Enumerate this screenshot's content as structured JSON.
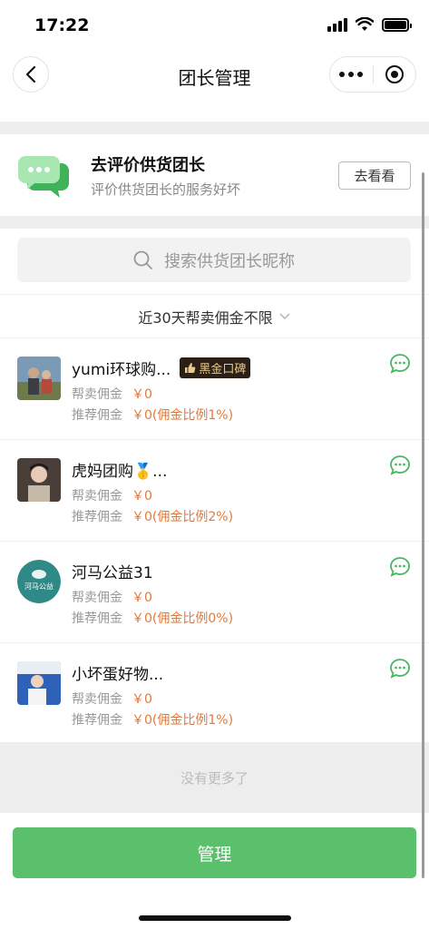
{
  "status_bar": {
    "time": "17:22"
  },
  "nav": {
    "title": "团长管理"
  },
  "eval_card": {
    "title": "去评价供货团长",
    "subtitle": "评价供货团长的服务好坏",
    "button": "去看看"
  },
  "search": {
    "placeholder": "搜索供货团长昵称"
  },
  "filter": {
    "label": "近30天帮卖佣金不限"
  },
  "leaders": [
    {
      "name": "yumi环球购...",
      "badge": "黑金口碑",
      "sell_label": "帮卖佣金",
      "sell_amount": "￥0",
      "ref_label": "推荐佣金",
      "ref_amount": "￥0(佣金比例1%)"
    },
    {
      "name": "虎妈团购🥇...",
      "badge": "",
      "sell_label": "帮卖佣金",
      "sell_amount": "￥0",
      "ref_label": "推荐佣金",
      "ref_amount": "￥0(佣金比例2%)"
    },
    {
      "name": "河马公益31",
      "badge": "",
      "avatar_text": "河马公益",
      "sell_label": "帮卖佣金",
      "sell_amount": "￥0",
      "ref_label": "推荐佣金",
      "ref_amount": "￥0(佣金比例0%)"
    },
    {
      "name": "小坏蛋好物...",
      "badge": "",
      "sell_label": "帮卖佣金",
      "sell_amount": "￥0",
      "ref_label": "推荐佣金",
      "ref_amount": "￥0(佣金比例1%)"
    }
  ],
  "footer": {
    "no_more": "没有更多了",
    "manage_button": "管理"
  },
  "colors": {
    "accent_green": "#5ac06b",
    "amount_orange": "#e07a3c"
  },
  "icons": [
    "back-arrow-icon",
    "more-dots-icon",
    "target-icon",
    "chat-bubbles-icon",
    "search-icon",
    "chevron-down-icon",
    "chat-icon",
    "thumbs-up-icon"
  ]
}
